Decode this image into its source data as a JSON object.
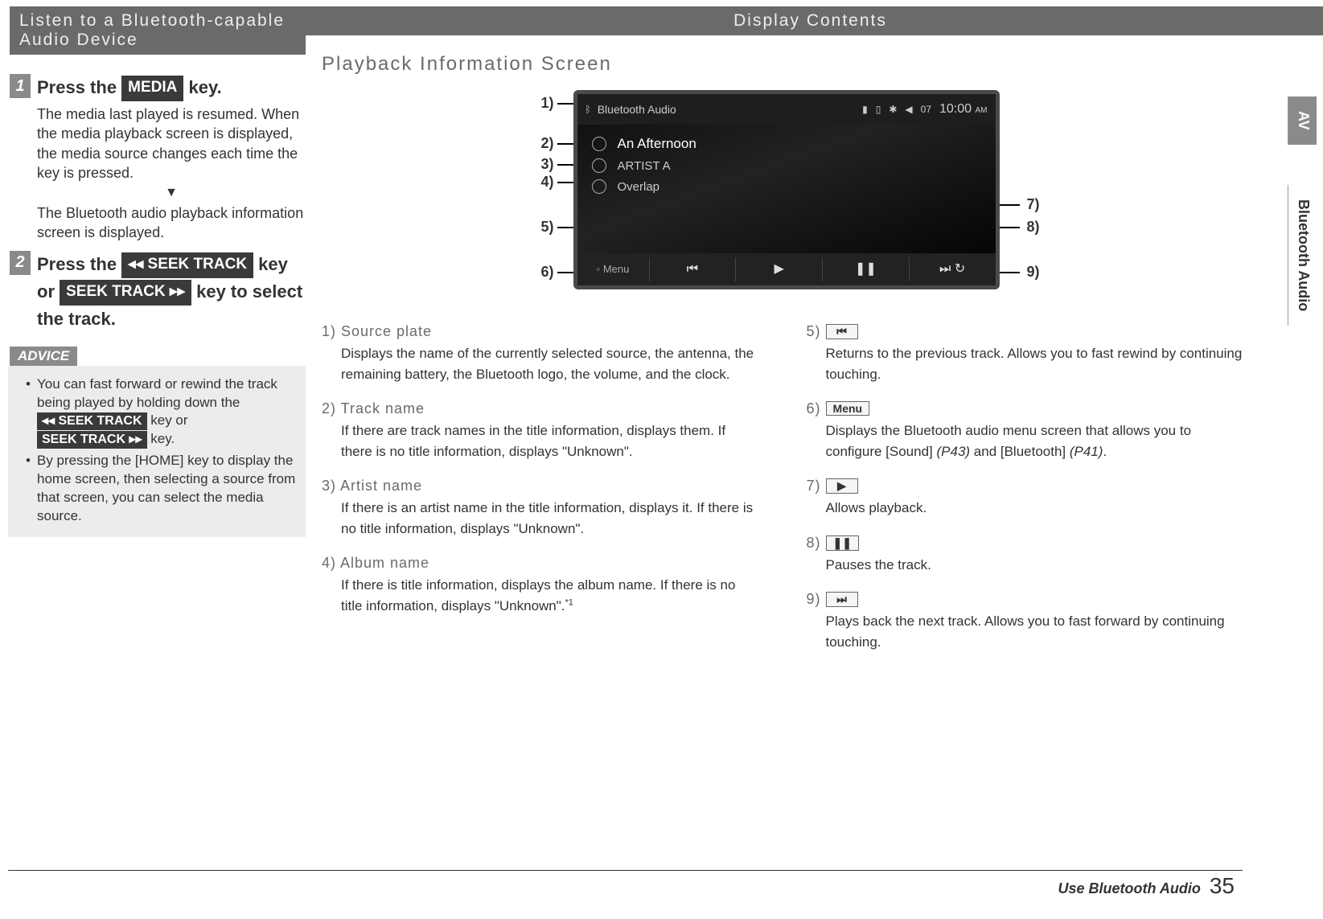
{
  "left": {
    "sectionTitle": "Listen to a Bluetooth-capable Audio Device",
    "step1": {
      "num": "1",
      "title_a": "Press the ",
      "key": "MEDIA",
      "title_b": " key.",
      "line1": "The media last played is resumed. When the media playback screen is displayed, the media source changes each time the key is pressed.",
      "line2": "The Bluetooth audio playback information screen is displayed."
    },
    "step2": {
      "num": "2",
      "t1": "Press the ",
      "k1": "◂◂ SEEK TRACK",
      "t2": " key or ",
      "k2": "SEEK TRACK ▸▸",
      "t3": " key to select the track."
    },
    "adviceHdr": "ADVICE",
    "adv1a": "You can fast forward or rewind the track being played by holding down the ",
    "adv1k1": "◂◂ SEEK TRACK",
    "adv1b": " key or ",
    "adv1k2": "SEEK TRACK ▸▸",
    "adv1c": " key.",
    "adv2": "By pressing the [HOME] key to display the home screen, then selecting a source from that screen, you can select the media source."
  },
  "right": {
    "sectionTitle": "Display Contents",
    "subsection": "Playback Information Screen"
  },
  "shot": {
    "source": "Bluetooth Audio",
    "sig": "07",
    "time": "10:00",
    "ampm": "AM",
    "track": "An Afternoon",
    "artist": "ARTIST A",
    "album": "Overlap",
    "menu": "Menu",
    "prev": "⏮",
    "play": "▶",
    "pause": "❚❚",
    "next": "⏭"
  },
  "labels": {
    "l1": "1)",
    "l2": "2)",
    "l3": "3)",
    "l4": "4)",
    "l5": "5)",
    "l6": "6)",
    "l7": "7)",
    "l8": "8)",
    "l9": "9)"
  },
  "defs": {
    "d1": {
      "h": "1) Source plate",
      "b": "Displays the name of the currently selected source, the antenna, the remaining battery, the Bluetooth logo, the volume, and the clock."
    },
    "d2": {
      "h": "2) Track name",
      "b": "If there are track names in the title information, displays them. If there is no title information, displays \"Unknown\"."
    },
    "d3": {
      "h": "3) Artist name",
      "b": "If there is an artist name in the title information, displays it. If there is no title information, displays \"Unknown\"."
    },
    "d4": {
      "h": "4) Album name",
      "b": "If there is title information, displays the album name. If there is no title information, displays \"Unknown\".",
      "sup": "*1"
    },
    "d5": {
      "n": "5)",
      "icon": "⏮",
      "b": "Returns to the previous track. Allows you to fast rewind by continuing touching."
    },
    "d6": {
      "n": "6)",
      "icon": "Menu",
      "b1": "Displays the Bluetooth audio menu screen that allows you to configure [Sound] ",
      "r1": "(P43)",
      "b2": " and [Bluetooth] ",
      "r2": "(P41)",
      "b3": "."
    },
    "d7": {
      "n": "7)",
      "icon": "▶",
      "b": "Allows playback."
    },
    "d8": {
      "n": "8)",
      "icon": "❚❚",
      "b": "Pauses the track."
    },
    "d9": {
      "n": "9)",
      "icon": "⏭",
      "b": "Plays back the next track. Allows you to fast forward by continuing touching."
    }
  },
  "side": {
    "a": "AV",
    "b": "Bluetooth Audio"
  },
  "footer": {
    "t": "Use Bluetooth Audio",
    "p": "35"
  }
}
